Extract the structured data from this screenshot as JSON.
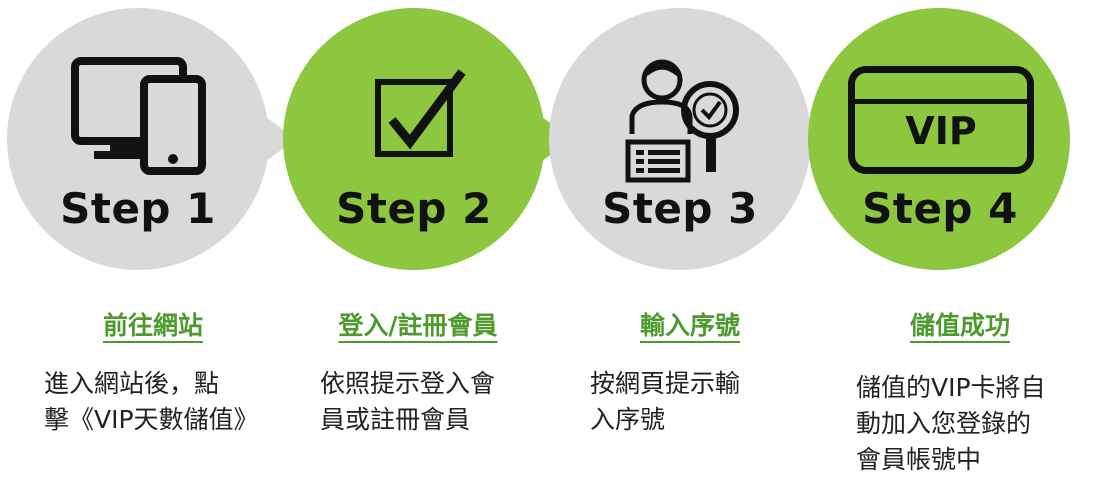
{
  "steps": [
    {
      "label": "Step 1",
      "title": "前往網站",
      "desc": "進入網站後，點\n擊《VIP天數儲值》",
      "icon": "devices-icon",
      "color": "#d9d9d9"
    },
    {
      "label": "Step 2",
      "title": "登入/註冊會員",
      "desc": "依照提示登入會\n員或註冊會員",
      "icon": "checkbox-icon",
      "color": "#8dc63f"
    },
    {
      "label": "Step 3",
      "title": "輸入序號",
      "desc": "按網頁提示輸\n入序號",
      "icon": "user-search-icon",
      "color": "#d9d9d9"
    },
    {
      "label": "Step 4",
      "title": "儲值成功",
      "desc": "儲值的VIP卡將自\n動加入您登錄的\n會員帳號中",
      "icon": "vip-card-icon",
      "color": "#8dc63f",
      "card_text": "VIP"
    }
  ],
  "colors": {
    "gray": "#d9d9d9",
    "green": "#8dc63f",
    "title": "#4f9a2c"
  }
}
